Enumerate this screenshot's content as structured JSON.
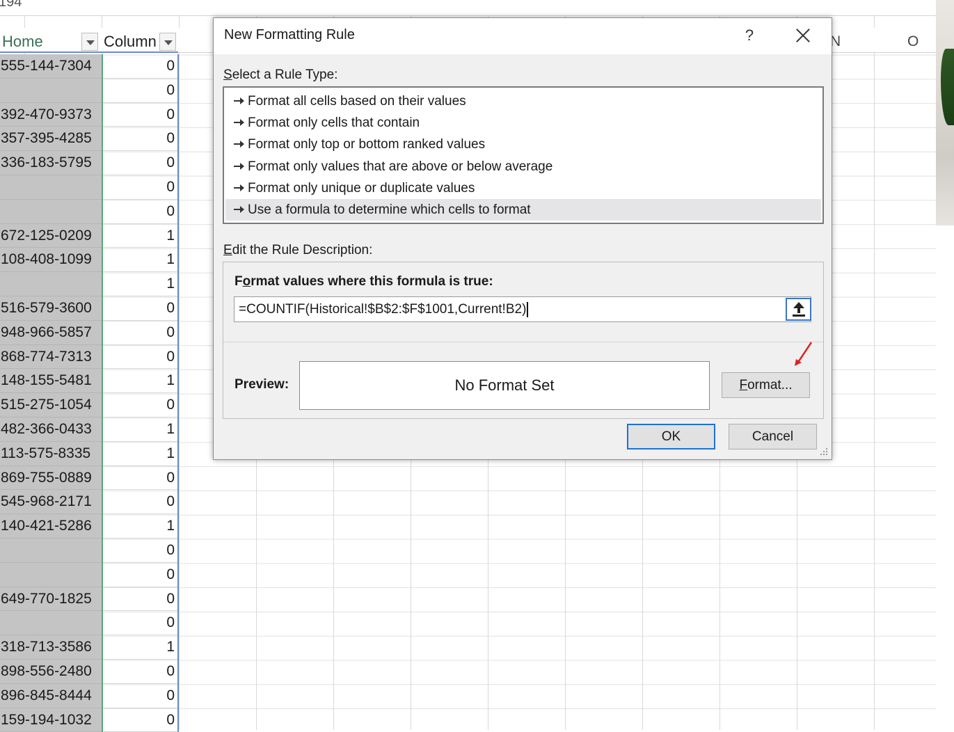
{
  "sheet": {
    "cell_ref": "194",
    "headers": {
      "home": "Home",
      "column": "Column"
    },
    "column_letters": [
      "N",
      "O"
    ],
    "phones": [
      "555-144-7304",
      "",
      "392-470-9373",
      "357-395-4285",
      "336-183-5795",
      "",
      "",
      "672-125-0209",
      "108-408-1099",
      "",
      "516-579-3600",
      "948-966-5857",
      "868-774-7313",
      "148-155-5481",
      "515-275-1054",
      "482-366-0433",
      "113-575-8335",
      "869-755-0889",
      "545-968-2171",
      "140-421-5286",
      "",
      "",
      "649-770-1825",
      "",
      "318-713-3586",
      "898-556-2480",
      "896-845-8444",
      "159-194-1032"
    ],
    "values": [
      "0",
      "0",
      "0",
      "0",
      "0",
      "0",
      "0",
      "1",
      "1",
      "1",
      "0",
      "0",
      "0",
      "1",
      "0",
      "1",
      "1",
      "0",
      "0",
      "1",
      "0",
      "0",
      "0",
      "0",
      "1",
      "0",
      "0",
      "0"
    ]
  },
  "dialog": {
    "title": "New Formatting Rule",
    "help": "?",
    "select_rule_type_label": {
      "accel": "S",
      "rest": "elect a Rule Type:"
    },
    "rule_types": [
      "Format all cells based on their values",
      "Format only cells that contain",
      "Format only top or bottom ranked values",
      "Format only values that are above or below average",
      "Format only unique or duplicate values",
      "Use a formula to determine which cells to format"
    ],
    "selected_rule_index": 5,
    "edit_rule_label": {
      "accel": "E",
      "rest": "dit the Rule Description:"
    },
    "formula_label": {
      "pre": "F",
      "accel": "o",
      "rest": "rmat values where this formula is true:"
    },
    "formula_value": "=COUNTIF(Historical!$B$2:$F$1001,Current!B2)",
    "preview_label": "Preview:",
    "preview_text": "No Format Set",
    "format_button": {
      "accel": "F",
      "rest": "ormat..."
    },
    "ok_button": "OK",
    "cancel_button": "Cancel"
  },
  "colors": {
    "accent_blue": "#1c73d1",
    "selected_rule_bg": "#e5e5e8",
    "annotation_red": "#e02020"
  }
}
